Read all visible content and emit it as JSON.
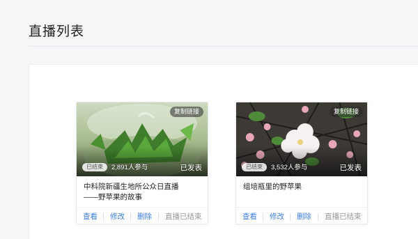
{
  "page": {
    "title": "直播列表"
  },
  "cards": [
    {
      "copy_link": "复制链接",
      "status": "已结束",
      "viewers": "2,891人参与",
      "published": "已发表",
      "title_line1": "中科院新疆生地所公众日直播",
      "title_line2": "——野苹果的故事",
      "actions": {
        "view": "查看",
        "edit": "修改",
        "delete": "删除",
        "ended": "直播已结束"
      }
    },
    {
      "copy_link": "复制链接",
      "status": "已结束",
      "viewers": "3,532人参与",
      "published": "已发表",
      "title_line1": "组培瓶里的野苹果",
      "title_line2": "",
      "actions": {
        "view": "查看",
        "edit": "修改",
        "delete": "删除",
        "ended": "直播已结束"
      }
    }
  ],
  "colors": {
    "link": "#3e7ee0",
    "ended": "#999999",
    "background": "#f5f6f8"
  }
}
